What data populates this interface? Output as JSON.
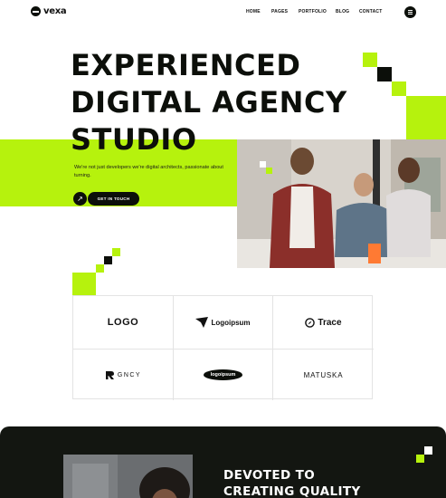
{
  "brand": {
    "name": "vexa"
  },
  "nav": {
    "items": [
      "HOME",
      "PAGES",
      "PORTFOLIO",
      "BLOG",
      "CONTACT"
    ]
  },
  "hero": {
    "title": "EXPERIENCED\nDIGITAL AGENCY\nSTUDIO",
    "subtitle": "We're not just developers we're digital architects, passionate about turning.",
    "cta_label": "GET IN TOUCH",
    "accent_color": "#b6f20d",
    "dark_color": "#0c0f0a"
  },
  "partners": {
    "logos": [
      "LOGO",
      "Logoipsum",
      "Trace",
      "GNCY",
      "logoipsum",
      "MATUSKA"
    ]
  },
  "section2": {
    "title": "DEVOTED TO\nCREATING QUALITY"
  },
  "icons": [
    "menu-icon",
    "arrow-up-right-icon",
    "globe-logo-icon"
  ]
}
